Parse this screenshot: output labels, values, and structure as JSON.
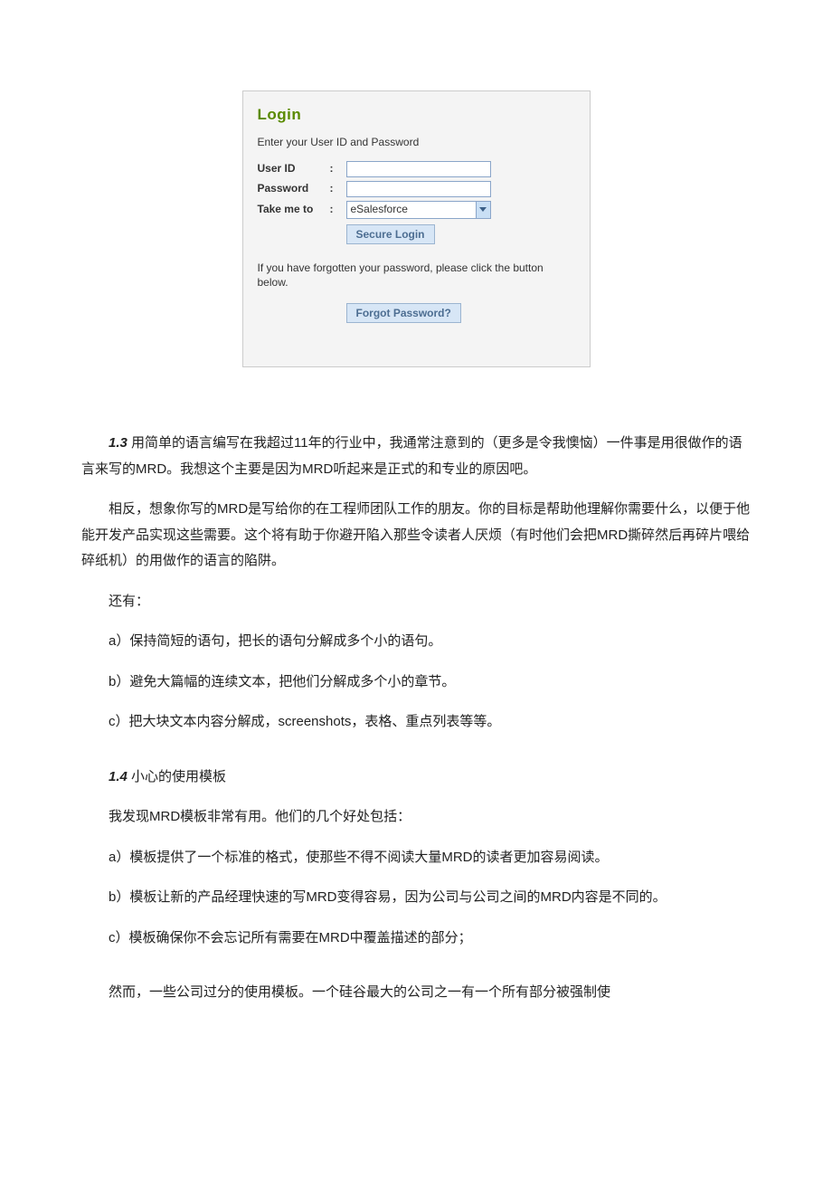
{
  "login": {
    "title": "Login",
    "subtitle": "Enter your User ID and Password",
    "userIdLabel": "User ID",
    "passwordLabel": "Password",
    "takeMeToLabel": "Take me to",
    "colon": ":",
    "takeMeToValue": "eSalesforce",
    "secureLoginLabel": "Secure Login",
    "forgotText": "If you have forgotten your password, please click the button below.",
    "forgotButtonLabel": "Forgot Password?"
  },
  "body": {
    "s13_num": "1.3",
    "p1": " 用简单的语言编写在我超过11年的行业中，我通常注意到的（更多是令我懊恼）一件事是用很做作的语言来写的MRD。我想这个主要是因为MRD听起来是正式的和专业的原因吧。",
    "p2": "相反，想象你写的MRD是写给你的在工程师团队工作的朋友。你的目标是帮助他理解你需要什么，以便于他能开发产品实现这些需要。这个将有助于你避开陷入那些令读者人厌烦（有时他们会把MRD撕碎然后再碎片喂给碎纸机）的用做作的语言的陷阱。",
    "p3": "还有：",
    "p4": "a）保持简短的语句，把长的语句分解成多个小的语句。",
    "p5": "b）避免大篇幅的连续文本，把他们分解成多个小的章节。",
    "p6": "c）把大块文本内容分解成，screenshots，表格、重点列表等等。",
    "s14_num": "1.4",
    "s14_title": " 小心的使用模板",
    "p7": "我发现MRD模板非常有用。他们的几个好处包括：",
    "p8": "a）模板提供了一个标准的格式，使那些不得不阅读大量MRD的读者更加容易阅读。",
    "p9": "b）模板让新的产品经理快速的写MRD变得容易，因为公司与公司之间的MRD内容是不同的。",
    "p10": "c）模板确保你不会忘记所有需要在MRD中覆盖描述的部分；",
    "p11": "然而，一些公司过分的使用模板。一个硅谷最大的公司之一有一个所有部分被强制使"
  }
}
